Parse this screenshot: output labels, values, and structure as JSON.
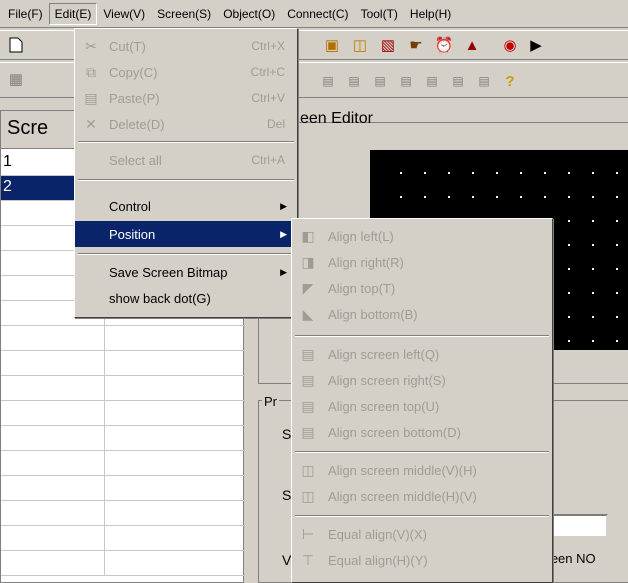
{
  "menubar": [
    "File(F)",
    "Edit(E)",
    "View(V)",
    "Screen(S)",
    "Object(O)",
    "Connect(C)",
    "Tool(T)",
    "Help(H)"
  ],
  "list_panel": {
    "header": "Scre",
    "rows": [
      "1",
      "2"
    ],
    "selected_row": "2"
  },
  "editor": {
    "title": "een Editor"
  },
  "properties": {
    "group_label": "Pr",
    "labels": [
      "S",
      "S",
      "V"
    ],
    "screen_no_label": "creen NO"
  },
  "edit_menu": {
    "items": [
      {
        "label": "Cut(T)",
        "shortcut": "Ctrl+X",
        "disabled": true,
        "icon": "scissors-icon"
      },
      {
        "label": "Copy(C)",
        "shortcut": "Ctrl+C",
        "disabled": true,
        "icon": "copy-icon"
      },
      {
        "label": "Paste(P)",
        "shortcut": "Ctrl+V",
        "disabled": true,
        "icon": "paste-icon"
      },
      {
        "label": "Delete(D)",
        "shortcut": "Del",
        "disabled": true,
        "icon": "delete-x-icon"
      },
      {
        "label": "Select all",
        "shortcut": "Ctrl+A",
        "disabled": true
      },
      {
        "label": "Control",
        "submenu": true
      },
      {
        "label": "Position",
        "submenu": true,
        "highlighted": true
      },
      {
        "label": "Save Screen Bitmap",
        "submenu": true
      },
      {
        "label": "show back dot(G)"
      }
    ]
  },
  "position_menu": {
    "items": [
      {
        "label": "Align left(L)",
        "icon": "align-left-icon"
      },
      {
        "label": "Align right(R)",
        "icon": "align-right-icon"
      },
      {
        "label": "Align top(T)",
        "icon": "align-top-icon"
      },
      {
        "label": "Align bottom(B)",
        "icon": "align-bottom-icon"
      },
      {
        "label": "Align screen left(Q)",
        "icon": "align-screen-left-icon"
      },
      {
        "label": "Align screen right(S)",
        "icon": "align-screen-right-icon"
      },
      {
        "label": "Align screen top(U)",
        "icon": "align-screen-top-icon"
      },
      {
        "label": "Align screen bottom(D)",
        "icon": "align-screen-bottom-icon"
      },
      {
        "label": "Align screen middle(V)(H)",
        "icon": "align-screen-middle-vh-icon"
      },
      {
        "label": "Align screen middle(H)(V)",
        "icon": "align-screen-middle-hv-icon"
      },
      {
        "label": "Equal align(V)(X)",
        "icon": "equal-align-v-icon"
      },
      {
        "label": "Equal align(H)(Y)",
        "icon": "equal-align-h-icon"
      }
    ]
  },
  "colors": {
    "face": "#d4d0c8",
    "highlight": "#0a246a",
    "disabled_text": "#a09c94",
    "canvas": "#000000"
  }
}
